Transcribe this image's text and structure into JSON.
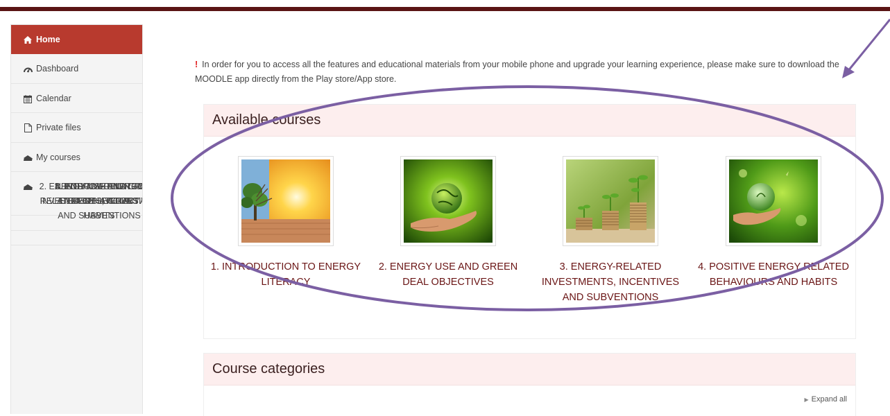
{
  "sidebar": {
    "items": [
      {
        "label": "Home",
        "icon": "home-icon"
      },
      {
        "label": "Dashboard",
        "icon": "dashboard-icon"
      },
      {
        "label": "Calendar",
        "icon": "calendar-icon"
      },
      {
        "label": "Private files",
        "icon": "file-icon"
      },
      {
        "label": "My courses",
        "icon": "graduation-cap-icon"
      },
      {
        "label": "1. INTRODUCTION TO ENERGY LITERACY",
        "icon": "graduation-cap-icon"
      },
      {
        "label": "2. ENERGY USE AND GREEN DEAL OBJECTIVES",
        "icon": "graduation-cap-icon"
      },
      {
        "label": "3. ENERGY-RELATED INVESTMENTS, INCENTIVES AND SUBVENTIONS",
        "icon": "graduation-cap-icon"
      },
      {
        "label": "4. POSITIVE ENERGY RELATED BEHAVIOURS AND HABITS",
        "icon": "graduation-cap-icon"
      }
    ]
  },
  "notice": {
    "mark": "!",
    "text": "In order for you to access all the features and educational materials  from your mobile phone and upgrade your learning experience, please make sure to download the MOODLE app directly from the Play store/App store."
  },
  "available_courses": {
    "heading": "Available courses",
    "courses": [
      {
        "title": "1. INTRODUCTION TO ENERGY LITERACY",
        "image": "tree-sunset-image"
      },
      {
        "title": "2. ENERGY USE AND GREEN DEAL OBJECTIVES",
        "image": "globe-in-hand-image"
      },
      {
        "title": "3. ENERGY-RELATED INVESTMENTS, INCENTIVES AND SUBVENTIONS",
        "image": "coins-sprouts-image"
      },
      {
        "title": "4. POSITIVE ENERGY RELATED BEHAVIOURS AND HABITS",
        "image": "glass-globe-hand-image"
      }
    ]
  },
  "course_categories": {
    "heading": "Course categories",
    "expand_label": "Expand all"
  },
  "colors": {
    "active_nav": "#b83a2e",
    "panel_header": "#fdeeee",
    "course_title": "#6a1515",
    "annotation": "#7b5fa3"
  }
}
